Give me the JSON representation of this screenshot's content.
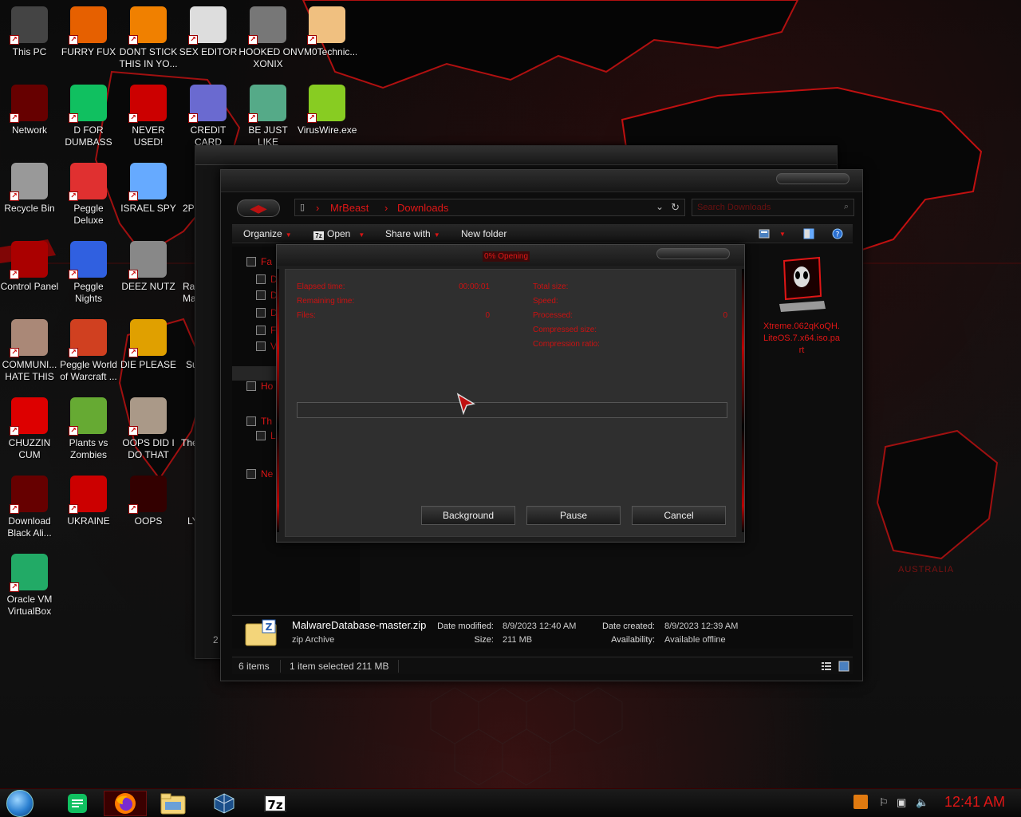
{
  "desktop": {
    "icons": [
      {
        "label": "This PC",
        "icon": "computer-icon",
        "color": "#444"
      },
      {
        "label": "FURRY FUX",
        "icon": "firefox-icon",
        "color": "#e66000"
      },
      {
        "label": "DONT STICK\nTHIS IN YO...",
        "icon": "vlc-cone-icon",
        "color": "#f08000"
      },
      {
        "label": "SEX EDITOR",
        "icon": "hxd-icon",
        "color": "#ddd"
      },
      {
        "label": "HOOKED ON\nXONIX",
        "icon": "xonix-icon",
        "color": "#777"
      },
      {
        "label": "VM0Technic...",
        "icon": "doctor-icon",
        "color": "#f0c080"
      },
      {
        "label": "Network",
        "icon": "alien-network-icon",
        "color": "#600"
      },
      {
        "label": "D FOR\nDUMBASS",
        "icon": "notes-icon",
        "color": "#10c060"
      },
      {
        "label": "NEVER USED!",
        "icon": "devcpp-icon",
        "color": "#c00"
      },
      {
        "label": "CREDIT CARD\nCHECKER",
        "icon": "credit-card-icon",
        "color": "#6a6ad0"
      },
      {
        "label": "BE JUST LIKE\nTHE DUDE!",
        "icon": "dude-icon",
        "color": "#5a8"
      },
      {
        "label": "VirusWire.exe",
        "icon": "limewire-icon",
        "color": "#8c2"
      },
      {
        "label": "Recycle Bin",
        "icon": "recycle-bin-icon",
        "color": "#999"
      },
      {
        "label": "Peggle Deluxe",
        "icon": "peggle-icon",
        "color": "#e03030"
      },
      {
        "label": "ISRAEL SPY",
        "icon": "spy-network-icon",
        "color": "#6af"
      },
      {
        "label": "Control Panel",
        "icon": "control-panel-icon",
        "color": "#a00"
      },
      {
        "label": "Peggle Nights\nDeluxe",
        "icon": "peggle-nights-icon",
        "color": "#3060e0"
      },
      {
        "label": "DEEZ NUTZ",
        "icon": "windows-stack-icon",
        "color": "#888"
      },
      {
        "label": "COMMUNI...\nHATE THIS ...",
        "icon": "money-bag-icon",
        "color": "#a87"
      },
      {
        "label": "Peggle World\nof Warcraft ...",
        "icon": "peggle-wow-icon",
        "color": "#d04020"
      },
      {
        "label": "DIE PLEASE",
        "icon": "de-icon",
        "color": "#e0a000"
      },
      {
        "label": "CHUZZIN\nCUM",
        "icon": "chuzzle-icon",
        "color": "#d00"
      },
      {
        "label": "Plants vs\nZombies",
        "icon": "plants-icon",
        "color": "#6a3"
      },
      {
        "label": "OOPS DID I\nDO THAT",
        "icon": "portrait-icon",
        "color": "#a98"
      },
      {
        "label": "Download\nBlack Ali...",
        "icon": "alien-download-icon",
        "color": "#600"
      },
      {
        "label": "UKRAINE",
        "icon": "radiation-icon",
        "color": "#c00"
      },
      {
        "label": "OOPS",
        "icon": "alienware-icon",
        "color": "#300"
      },
      {
        "label": "Oracle VM\nVirtualBox",
        "icon": "virtualbox-icon",
        "color": "#2a6"
      }
    ],
    "partial_labels": [
      "2P",
      "Ra\nMa",
      "Su",
      "The",
      "LY"
    ],
    "wallpaper_label": "AUSTRALIA"
  },
  "explorer": {
    "breadcrumb": [
      "MrBeast",
      "Downloads"
    ],
    "search_placeholder": "Search Downloads",
    "toolbar": {
      "organize": "Organize",
      "open": "Open",
      "share_with": "Share with",
      "new_folder": "New folder"
    },
    "nav_items": [
      "Fa",
      "D",
      "D",
      "D",
      "F",
      "V",
      "Ho",
      "Th",
      "L",
      "Ne"
    ],
    "preview_file": "Xtreme.062qKoQH.LiteOS.7.x64.iso.part",
    "details": {
      "file_name": "MalwareDatabase-master.zip",
      "file_type": "zip Archive",
      "date_modified_label": "Date modified:",
      "date_modified": "8/9/2023 12:40 AM",
      "size_label": "Size:",
      "size": "211 MB",
      "date_created_label": "Date created:",
      "date_created": "8/9/2023 12:39 AM",
      "availability_label": "Availability:",
      "availability": "Available offline"
    },
    "status": {
      "item_count": "6 items",
      "selection": "1 item selected  211 MB"
    }
  },
  "progress_dialog": {
    "title": "0% Opening",
    "progress_percent": 0,
    "left_stats": [
      {
        "label": "Elapsed time:",
        "value": "00:00:01"
      },
      {
        "label": "Remaining time:",
        "value": ""
      },
      {
        "label": "Files:",
        "value": "0"
      }
    ],
    "right_stats": [
      {
        "label": "Total size:",
        "value": ""
      },
      {
        "label": "Speed:",
        "value": ""
      },
      {
        "label": "Processed:",
        "value": "0"
      },
      {
        "label": "Compressed size:",
        "value": ""
      },
      {
        "label": "Compression ratio:",
        "value": ""
      }
    ],
    "buttons": {
      "background": "Background",
      "pause": "Pause",
      "cancel": "Cancel"
    }
  },
  "taskbar": {
    "apps": [
      "notes-icon",
      "firefox-icon",
      "file-explorer-icon",
      "virtualbox-icon",
      "7zip-icon"
    ],
    "clock": "12:41 AM",
    "seven_zip_label": "7z"
  },
  "colors": {
    "accent": "#e01616",
    "background": "#0d0d0d"
  }
}
